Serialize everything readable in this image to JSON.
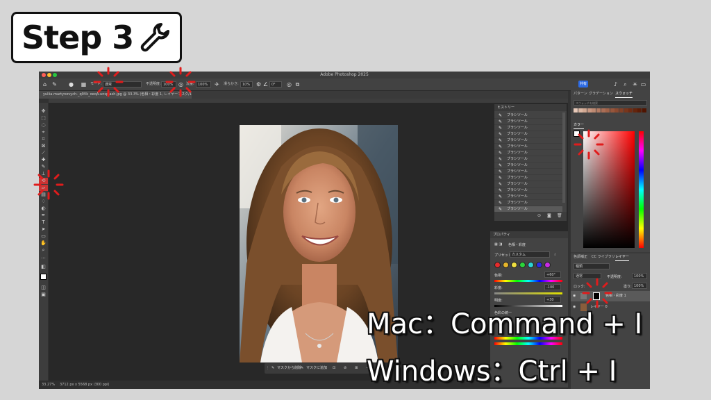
{
  "step": {
    "label": "Step 3",
    "icon": "wrench-icon"
  },
  "window": {
    "title": "Adobe Photoshop 2025"
  },
  "options_bar": {
    "mode_label": "モード:",
    "mode_value": "通常",
    "opacity_label": "不透明度:",
    "opacity_value": "100%",
    "flow_label": "流量:",
    "flow_value": "100%",
    "smoothing_label": "滑らかさ:",
    "smoothing_value": "10%",
    "angle_value": "0°",
    "share_label": "共有"
  },
  "document": {
    "tab_title": "yuliia-martynovych-_q9Vk_oeqA-unsplash.jpg @ 33.3% (色相・彩度 1, レイヤーマスク/16) *",
    "zoom": "33.27%",
    "size_info": "3712 px x 5568 px (300 ppi)"
  },
  "task_bar": {
    "subtract_label": "マスクから削除",
    "add_label": "マスクに追加"
  },
  "history": {
    "title": "ヒストリー",
    "items": [
      "ブラシツール",
      "ブラシツール",
      "ブラシツール",
      "ブラシツール",
      "ブラシツール",
      "ブラシツール",
      "ブラシツール",
      "ブラシツール",
      "ブラシツール",
      "ブラシツール",
      "ブラシツール",
      "ブラシツール",
      "ブラシツール",
      "ブラシツール",
      "ブラシツール",
      "ブラシツール"
    ]
  },
  "properties": {
    "title": "プロパティ",
    "adjustment": "色相・彩度",
    "preset_label": "プリセット:",
    "preset_value": "カスタム",
    "hue_label": "色相:",
    "hue_value": "+60°",
    "saturation_label": "彩度:",
    "saturation_value": "-100",
    "lightness_label": "明度:",
    "lightness_value": "+30",
    "colorize_label": "色彩の統一",
    "swatches": [
      "#e52b2b",
      "#e5b52b",
      "#f0e040",
      "#2bd43a",
      "#2bd4d4",
      "#2b2be5",
      "#c82be5"
    ]
  },
  "swatches_panel": {
    "tabs": [
      "パターン",
      "グラデーション",
      "スウォッチ"
    ],
    "search_placeholder": "スウォッチを検索",
    "chips": [
      "#e8c9b8",
      "#dcb8a4",
      "#d2a892",
      "#c89882",
      "#be8a72",
      "#b47c64",
      "#aa6e56",
      "#a06248",
      "#96563c",
      "#8c4a30",
      "#824026",
      "#78361c",
      "#6e2c14",
      "#64240c",
      "#5a1c06",
      "#501400"
    ]
  },
  "color_panel": {
    "title": "カラー"
  },
  "layers_panel": {
    "tabs": [
      "色調補正",
      "CC ライブラリ",
      "レイヤー"
    ],
    "kind_label": "種類",
    "blend_mode": "通常",
    "opacity_label": "不透明度:",
    "opacity_value": "100%",
    "lock_label": "ロック:",
    "fill_label": "塗り:",
    "fill_value": "100%",
    "layers": [
      {
        "name": "色相・彩度 1"
      },
      {
        "name": "レイヤー 0"
      }
    ]
  },
  "shortcuts": {
    "mac": "Mac：Command + I",
    "windows": "Windows：Ctrl + I"
  },
  "colors": {
    "accent_blue": "#2d6be4",
    "burst_red": "#e01c1c"
  }
}
